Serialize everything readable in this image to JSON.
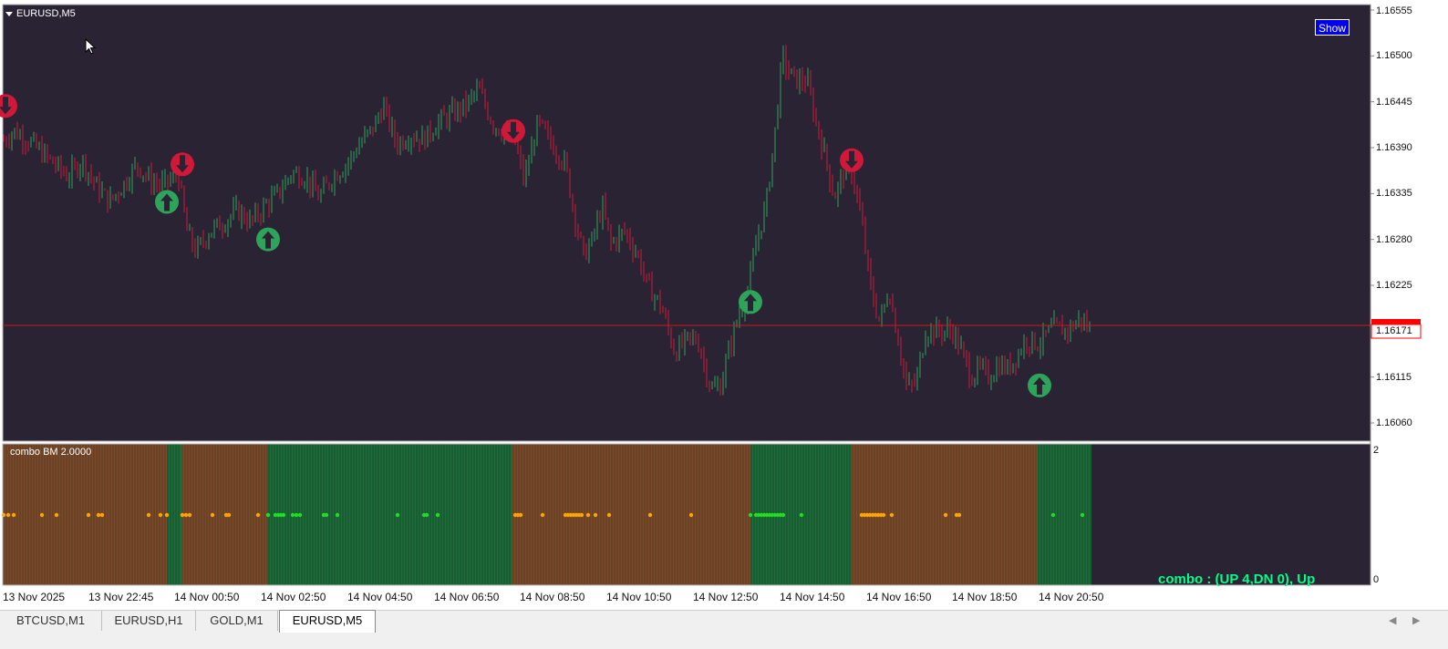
{
  "window": {
    "title": "EURUSD,M5",
    "show_button": "Show"
  },
  "price_axis": {
    "labels": [
      "1.16555",
      "1.16500",
      "1.16445",
      "1.16390",
      "1.16335",
      "1.16280",
      "1.16225",
      "1.16171",
      "1.16115",
      "1.16060"
    ],
    "current_price": "1.16171",
    "current_price_color": "#ff0000"
  },
  "indicator": {
    "name": "combo BM  2.0000",
    "scale_top": "2",
    "scale_bottom": "0",
    "status_text": "combo : (UP 4,DN 0), Up",
    "colors": {
      "bull": "#1e6b3c",
      "bear": "#7a4a2a",
      "dot_bear": "#ffa500",
      "dot_bull": "#22dd22"
    },
    "segments": [
      {
        "state": "bear",
        "from": 3,
        "to": 183
      },
      {
        "state": "bull",
        "from": 183,
        "to": 199
      },
      {
        "state": "bear",
        "from": 199,
        "to": 294
      },
      {
        "state": "bull",
        "from": 294,
        "to": 562
      },
      {
        "state": "bear",
        "from": 562,
        "to": 823
      },
      {
        "state": "bull",
        "from": 823,
        "to": 934
      },
      {
        "state": "bear",
        "from": 934,
        "to": 1138
      },
      {
        "state": "bull",
        "from": 1138,
        "to": 1197
      }
    ]
  },
  "time_axis": {
    "labels": [
      "13 Nov 2025",
      "13 Nov 22:45",
      "14 Nov 00:50",
      "14 Nov 02:50",
      "14 Nov 04:50",
      "14 Nov 06:50",
      "14 Nov 08:50",
      "14 Nov 10:50",
      "14 Nov 12:50",
      "14 Nov 14:50",
      "14 Nov 16:50",
      "14 Nov 18:50",
      "14 Nov 20:50"
    ]
  },
  "chart_data": {
    "type": "candlestick",
    "symbol": "EURUSD",
    "timeframe": "M5",
    "ylim": [
      1.1604,
      1.16575
    ],
    "bull_color": "#2ea35a",
    "bear_color": "#d01838",
    "path": [
      [
        0,
        1.16395
      ],
      [
        15,
        1.1641
      ],
      [
        30,
        1.164
      ],
      [
        45,
        1.16385
      ],
      [
        60,
        1.1637
      ],
      [
        75,
        1.16355
      ],
      [
        90,
        1.16375
      ],
      [
        105,
        1.16345
      ],
      [
        120,
        1.16325
      ],
      [
        135,
        1.16345
      ],
      [
        150,
        1.1637
      ],
      [
        165,
        1.1635
      ],
      [
        180,
        1.16345
      ],
      [
        195,
        1.1636
      ],
      [
        205,
        1.1629
      ],
      [
        215,
        1.16265
      ],
      [
        230,
        1.1629
      ],
      [
        245,
        1.163
      ],
      [
        260,
        1.16315
      ],
      [
        275,
        1.163
      ],
      [
        290,
        1.1632
      ],
      [
        305,
        1.16335
      ],
      [
        320,
        1.1636
      ],
      [
        335,
        1.16355
      ],
      [
        350,
        1.1633
      ],
      [
        365,
        1.16355
      ],
      [
        380,
        1.1637
      ],
      [
        395,
        1.16395
      ],
      [
        410,
        1.16415
      ],
      [
        420,
        1.1644
      ],
      [
        435,
        1.16395
      ],
      [
        450,
        1.16405
      ],
      [
        465,
        1.164
      ],
      [
        480,
        1.1642
      ],
      [
        495,
        1.1643
      ],
      [
        510,
        1.1644
      ],
      [
        525,
        1.1646
      ],
      [
        540,
        1.1642
      ],
      [
        555,
        1.16405
      ],
      [
        565,
        1.16395
      ],
      [
        575,
        1.1635
      ],
      [
        590,
        1.1642
      ],
      [
        605,
        1.16395
      ],
      [
        620,
        1.1637
      ],
      [
        630,
        1.1631
      ],
      [
        640,
        1.1626
      ],
      [
        650,
        1.1628
      ],
      [
        660,
        1.1632
      ],
      [
        670,
        1.16275
      ],
      [
        685,
        1.1629
      ],
      [
        700,
        1.1626
      ],
      [
        710,
        1.16225
      ],
      [
        725,
        1.162
      ],
      [
        740,
        1.16145
      ],
      [
        755,
        1.1616
      ],
      [
        765,
        1.1616
      ],
      [
        780,
        1.161
      ],
      [
        790,
        1.16105
      ],
      [
        800,
        1.1615
      ],
      [
        810,
        1.1619
      ],
      [
        820,
        1.16215
      ],
      [
        830,
        1.1628
      ],
      [
        840,
        1.1632
      ],
      [
        850,
        1.1641
      ],
      [
        858,
        1.165
      ],
      [
        865,
        1.1648
      ],
      [
        875,
        1.1647
      ],
      [
        885,
        1.1647
      ],
      [
        895,
        1.1642
      ],
      [
        905,
        1.1638
      ],
      [
        915,
        1.1633
      ],
      [
        925,
        1.1636
      ],
      [
        935,
        1.1636
      ],
      [
        945,
        1.163
      ],
      [
        955,
        1.1622
      ],
      [
        965,
        1.1618
      ],
      [
        975,
        1.1622
      ],
      [
        985,
        1.1616
      ],
      [
        995,
        1.161
      ],
      [
        1005,
        1.1611
      ],
      [
        1015,
        1.1617
      ],
      [
        1030,
        1.1617
      ],
      [
        1045,
        1.1617
      ],
      [
        1055,
        1.16145
      ],
      [
        1065,
        1.16115
      ],
      [
        1075,
        1.16125
      ],
      [
        1085,
        1.16115
      ],
      [
        1095,
        1.1613
      ],
      [
        1105,
        1.16125
      ],
      [
        1115,
        1.1614
      ],
      [
        1125,
        1.1616
      ],
      [
        1140,
        1.16155
      ],
      [
        1155,
        1.16175
      ],
      [
        1170,
        1.1617
      ],
      [
        1185,
        1.16185
      ],
      [
        1197,
        1.1617
      ]
    ],
    "signals": [
      {
        "dir": "down",
        "x": 6,
        "y": 1.1644
      },
      {
        "dir": "up",
        "x": 183,
        "y": 1.16325
      },
      {
        "dir": "down",
        "x": 200,
        "y": 1.1637
      },
      {
        "dir": "up",
        "x": 294,
        "y": 1.1628
      },
      {
        "dir": "down",
        "x": 563,
        "y": 1.1641
      },
      {
        "dir": "up",
        "x": 823,
        "y": 1.16205
      },
      {
        "dir": "down",
        "x": 934,
        "y": 1.16375
      },
      {
        "dir": "up",
        "x": 1140,
        "y": 1.16105
      }
    ]
  }
}
